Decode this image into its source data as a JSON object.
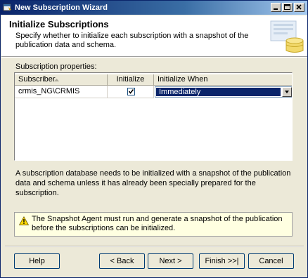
{
  "window": {
    "title": "New Subscription Wizard"
  },
  "header": {
    "title": "Initialize Subscriptions",
    "subtitle": "Specify whether to initialize each subscription with a snapshot of the publication data and schema."
  },
  "properties_label": "Subscription properties:",
  "grid": {
    "columns": [
      "Subscriber",
      "Initialize",
      "Initialize When"
    ],
    "rows": [
      {
        "subscriber": "crmis_NG\\CRMIS",
        "initialize": true,
        "initialize_when": "Immediately"
      }
    ]
  },
  "description": "A subscription database needs to be initialized with a snapshot of the publication data and schema unless it has already been specially prepared for the subscription.",
  "warning": "The Snapshot Agent must run and generate a snapshot of the publication before the subscriptions can be initialized.",
  "buttons": {
    "help": "Help",
    "back": "< Back",
    "next": "Next >",
    "finish": "Finish >>|",
    "cancel": "Cancel"
  },
  "colors": {
    "titlebar": "#0a246a",
    "selection": "#0a246a",
    "warning_bg": "#ffffe1"
  }
}
